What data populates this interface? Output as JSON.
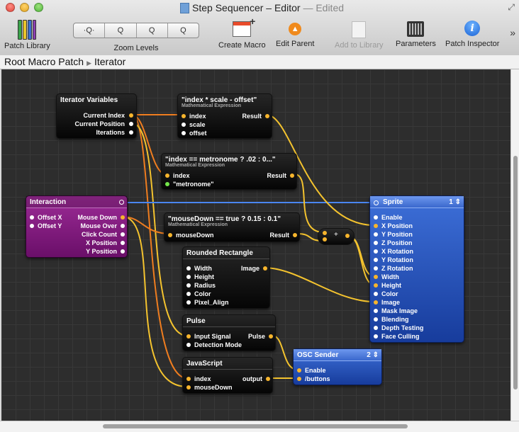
{
  "window": {
    "title": "Step Sequencer – Editor",
    "edited": "— Edited"
  },
  "toolbar": {
    "patch_library": "Patch Library",
    "zoom_levels": "Zoom Levels",
    "zoom_buttons": [
      "·Q·",
      "Q",
      "Q",
      "Q"
    ],
    "create_macro": "Create Macro",
    "edit_parent": "Edit Parent",
    "add_to_library": "Add to Library",
    "parameters": "Parameters",
    "patch_inspector": "Patch Inspector"
  },
  "breadcrumb": [
    "Root Macro Patch",
    "Iterator"
  ],
  "nodes": {
    "iterator_vars": {
      "title": "Iterator Variables",
      "outputs": [
        "Current Index",
        "Current Position",
        "Iterations"
      ]
    },
    "math1": {
      "title": "\"index * scale - offset\"",
      "subtitle": "Mathematical Expression",
      "inputs": [
        "index",
        "scale",
        "offset"
      ],
      "output": "Result"
    },
    "math2": {
      "title": "\"index == metronome ? .02 : 0...\"",
      "subtitle": "Mathematical Expression",
      "inputs": [
        "index",
        "\"metronome\""
      ],
      "output": "Result"
    },
    "interaction": {
      "title": "Interaction",
      "inputs": [
        "Offset X",
        "Offset Y"
      ],
      "outputs": [
        "Mouse Down",
        "Mouse Over",
        "Click Count",
        "X Position",
        "Y Position"
      ]
    },
    "math3": {
      "title": "\"mouseDown == true ? 0.15 : 0.1\"",
      "subtitle": "Mathematical Expression",
      "inputs": [
        "mouseDown"
      ],
      "output": "Result"
    },
    "plus": {
      "label": "+"
    },
    "sprite": {
      "title": "Sprite",
      "badge": "1",
      "inputs": [
        "Enable",
        "X Position",
        "Y Position",
        "Z Position",
        "X Rotation",
        "Y Rotation",
        "Z Rotation",
        "Width",
        "Height",
        "Color",
        "Image",
        "Mask Image",
        "Blending",
        "Depth Testing",
        "Face Culling"
      ]
    },
    "rounded_rect": {
      "title": "Rounded Rectangle",
      "inputs": [
        "Width",
        "Height",
        "Radius",
        "Color",
        "Pixel_Align"
      ],
      "output": "Image"
    },
    "pulse": {
      "title": "Pulse",
      "inputs": [
        "Input Signal",
        "Detection Mode"
      ],
      "output": "Pulse"
    },
    "javascript": {
      "title": "JavaScript",
      "inputs": [
        "index",
        "mouseDown"
      ],
      "output": "output"
    },
    "osc": {
      "title": "OSC Sender",
      "badge": "2",
      "inputs": [
        "Enable",
        "/buttons"
      ]
    }
  },
  "colors": {
    "canvas": "#2d2d2d",
    "wire_yellow": "#f4c32e",
    "wire_orange": "#ef7d1f",
    "wire_blue": "#4a86f0",
    "macro_purple": "#8a1f86",
    "consumer_blue": "#2e5fcf"
  },
  "icons": {
    "patch_library": "books-icon",
    "create_macro": "window-plus-icon",
    "edit_parent": "up-arrow-circle-icon",
    "add_to_library": "document-plus-icon",
    "parameters": "sliders-icon",
    "patch_inspector": "info-icon"
  }
}
